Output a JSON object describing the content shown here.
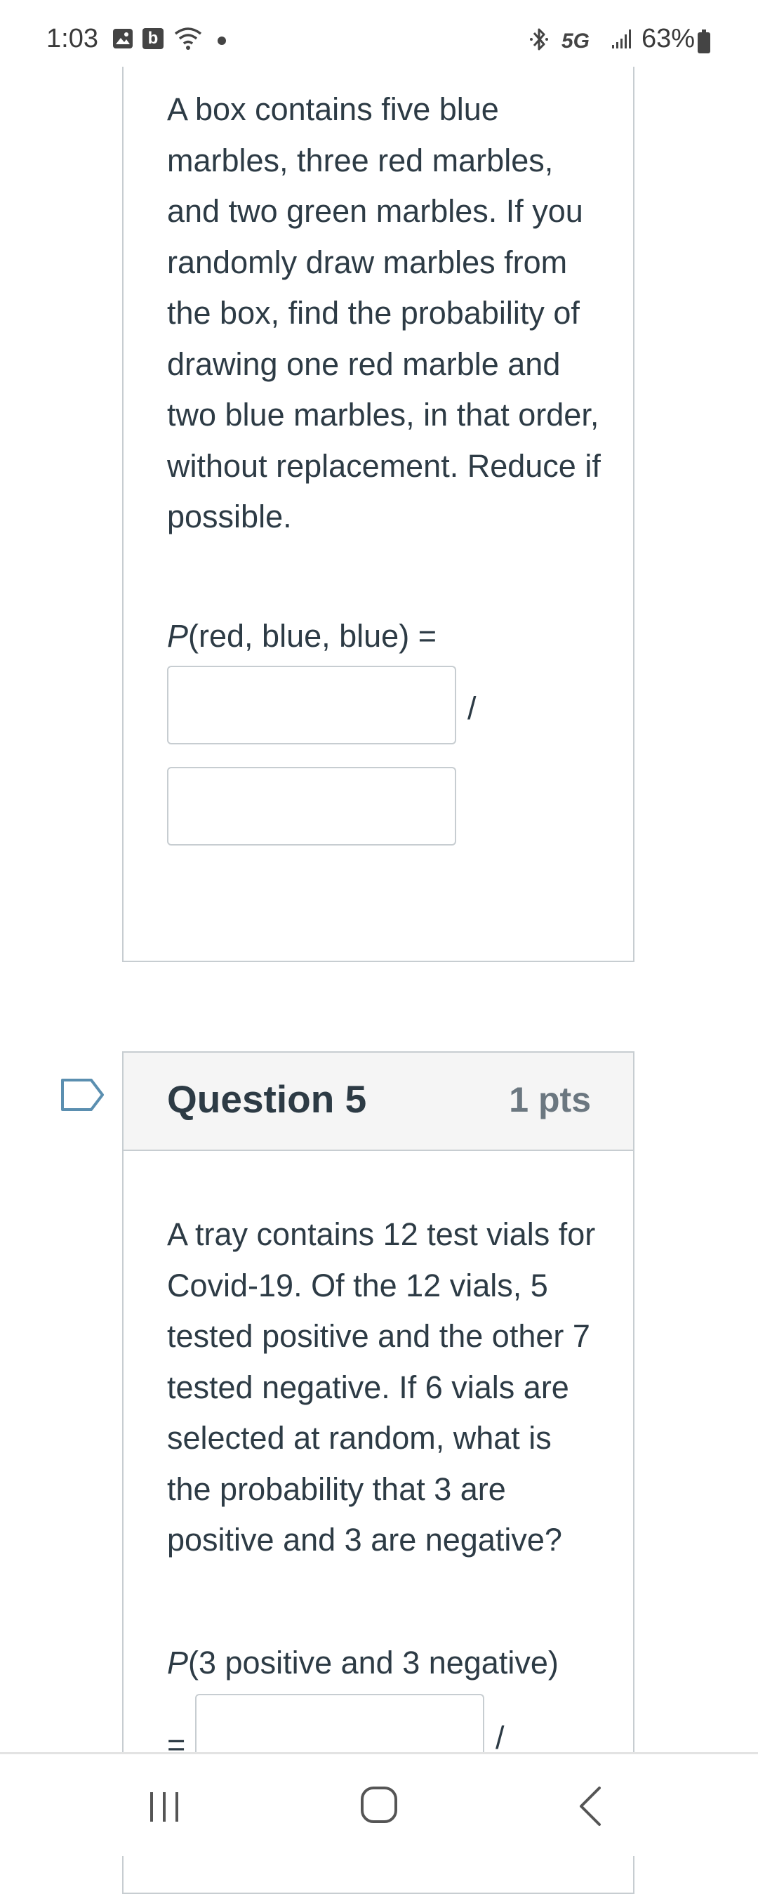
{
  "status_bar": {
    "time": "1:03",
    "b_icon_label": "b",
    "network": "5G",
    "battery": "63%"
  },
  "question4": {
    "text": "A box contains five blue marbles, three red marbles, and two green marbles. If you randomly draw marbles from the box, find the probability of drawing one red marble and two blue marbles, in that order, without replacement. Reduce if possible.",
    "prob_label_p": "P",
    "prob_label_rest": "(red, blue, blue) =",
    "numerator_value": "",
    "denominator_value": "",
    "slash": "/"
  },
  "question5": {
    "title": "Question 5",
    "points": "1 pts",
    "text": "A tray contains 12 test vials for Covid-19. Of the 12 vials, 5 tested positive and the other 7 tested negative. If 6 vials are selected at random, what is the probability that 3 are positive and 3 are negative?",
    "prob_label_p": "P",
    "prob_label_rest": "(3 positive and 3 negative)",
    "equals": "=",
    "numerator_value": "",
    "slash": "/"
  },
  "colors": {
    "text": "#2d3b45",
    "border": "#c7cdd1",
    "header_bg": "#f5f5f5",
    "flag": "#5b8fb0"
  }
}
